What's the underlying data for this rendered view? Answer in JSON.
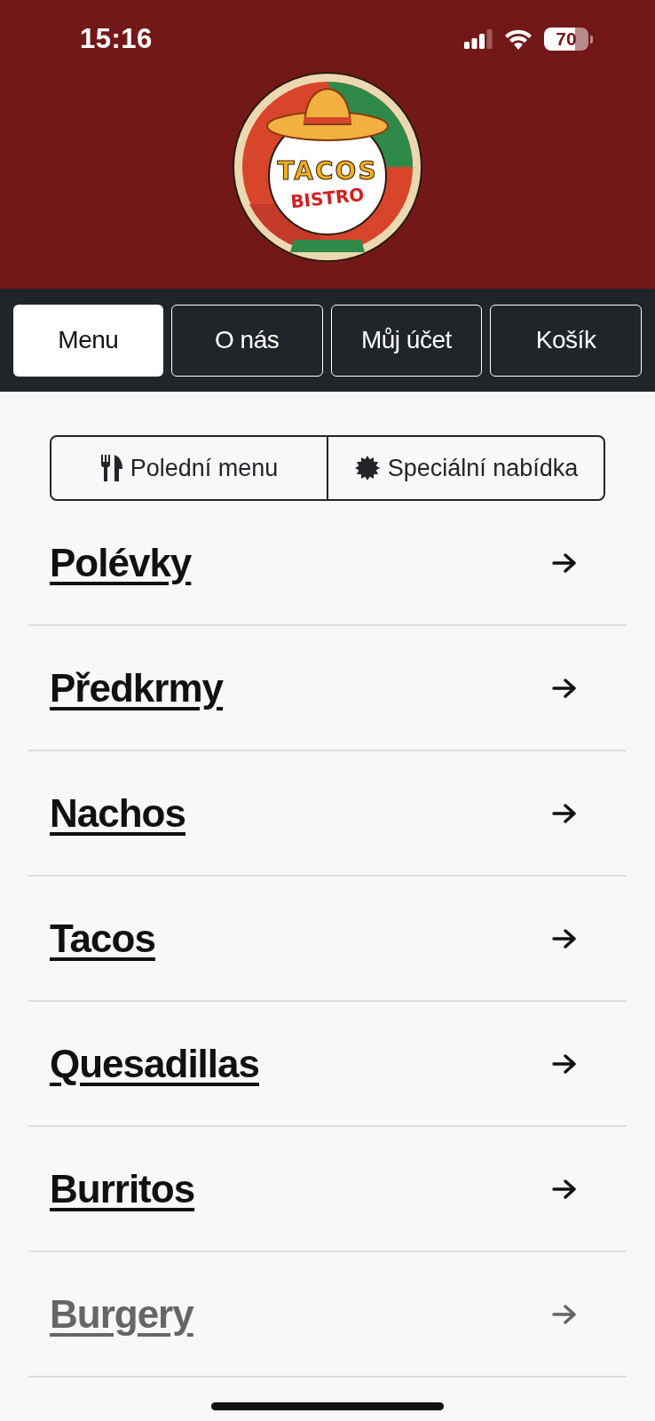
{
  "status_bar": {
    "time": "15:16",
    "battery": "70"
  },
  "logo": {
    "line1": "TACOS",
    "line2": "BISTRO"
  },
  "tabs": [
    {
      "label": "Menu",
      "selected": true
    },
    {
      "label": "O nás",
      "selected": false
    },
    {
      "label": "Můj účet",
      "selected": false
    },
    {
      "label": "Košík",
      "selected": false
    }
  ],
  "menu_types": [
    {
      "label": "Polední menu",
      "kind": "utensils"
    },
    {
      "label": "Speciální nabídka",
      "kind": "badge"
    }
  ],
  "categories": [
    {
      "label": "Polévky",
      "faded": false
    },
    {
      "label": "Předkrmy",
      "faded": false
    },
    {
      "label": "Nachos",
      "faded": false
    },
    {
      "label": "Tacos",
      "faded": false
    },
    {
      "label": "Quesadillas",
      "faded": false
    },
    {
      "label": "Burritos",
      "faded": false
    },
    {
      "label": "Burgery",
      "faded": true
    }
  ]
}
